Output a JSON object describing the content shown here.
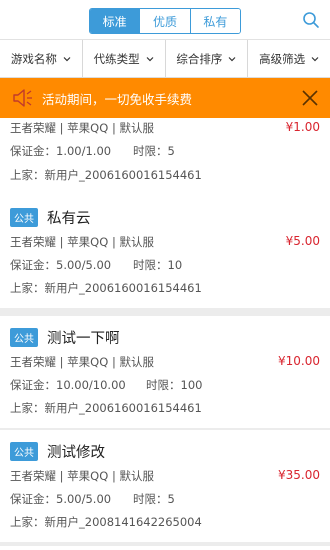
{
  "header": {
    "tabs": [
      {
        "label": "标准",
        "active": true
      },
      {
        "label": "优质",
        "active": false
      },
      {
        "label": "私有",
        "active": false
      }
    ],
    "search_icon": "search-icon"
  },
  "filters": [
    {
      "label": "游戏名称"
    },
    {
      "label": "代练类型"
    },
    {
      "label": "综合排序"
    },
    {
      "label": "高级筛选"
    }
  ],
  "notice": {
    "text": "活动期间，一切免收手续费",
    "icon": "speaker-icon",
    "close_icon": "close-icon"
  },
  "colors": {
    "accent": "#3d9bd9",
    "notice": "#ff8a00",
    "price": "#d9252f"
  },
  "orders": [
    {
      "badge": "",
      "title": "",
      "game_line": "王者荣耀 | 苹果QQ | 默认服",
      "price": "¥1.00",
      "deposit": "保证金：1.00/1.00",
      "time": "时限：5",
      "owner": "上家：新用户_2006160016154461"
    },
    {
      "badge": "公共",
      "title": "私有云",
      "game_line": "王者荣耀 | 苹果QQ | 默认服",
      "price": "¥5.00",
      "deposit": "保证金：5.00/5.00",
      "time": "时限：10",
      "owner": "上家：新用户_2006160016154461"
    },
    {
      "badge": "公共",
      "title": "测试一下啊",
      "game_line": "王者荣耀 | 苹果QQ | 默认服",
      "price": "¥10.00",
      "deposit": "保证金：10.00/10.00",
      "time": "时限：100",
      "owner": "上家：新用户_2006160016154461"
    },
    {
      "badge": "公共",
      "title": "测试修改",
      "game_line": "王者荣耀 | 苹果QQ | 默认服",
      "price": "¥35.00",
      "deposit": "保证金：5.00/5.00",
      "time": "时限：5",
      "owner": "上家：新用户_2008141642265004"
    }
  ]
}
